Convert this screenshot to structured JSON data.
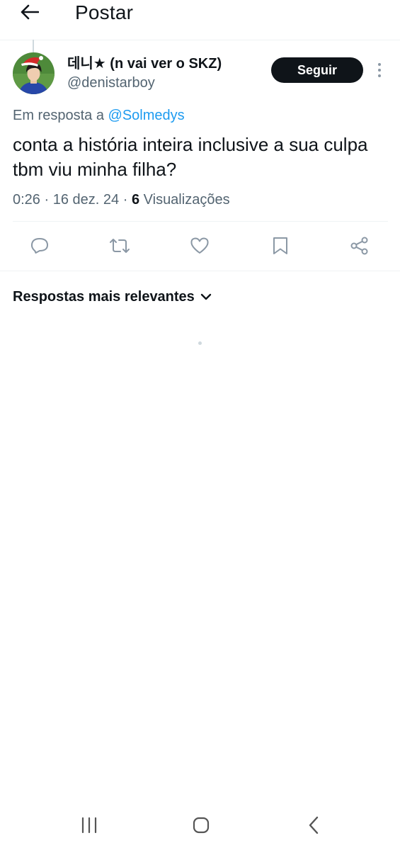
{
  "header": {
    "title": "Postar",
    "back_icon": "arrow-left-icon"
  },
  "tweet": {
    "author": {
      "display_name": "데니★ (n vai ver o SKZ)",
      "handle": "@denistarboy",
      "avatar_icon": "avatar-with-santa-hat"
    },
    "follow_label": "Seguir",
    "reply_prefix": "Em resposta a",
    "reply_to": "@Solmedys",
    "text": "conta a história inteira inclusive a sua culpa tbm viu minha filha?",
    "time": "0:26",
    "date": "16 dez. 24",
    "views_count": "6",
    "views_label": "Visualizações"
  },
  "actions": [
    "reply-icon",
    "repost-icon",
    "like-icon",
    "bookmark-icon",
    "share-icon"
  ],
  "replies": {
    "sort_label": "Respostas mais relevantes"
  },
  "colors": {
    "text": "#0f1419",
    "secondary": "#536471",
    "accent": "#1d9bf0",
    "button": "#0f1419",
    "icon": "#8b98a5"
  }
}
